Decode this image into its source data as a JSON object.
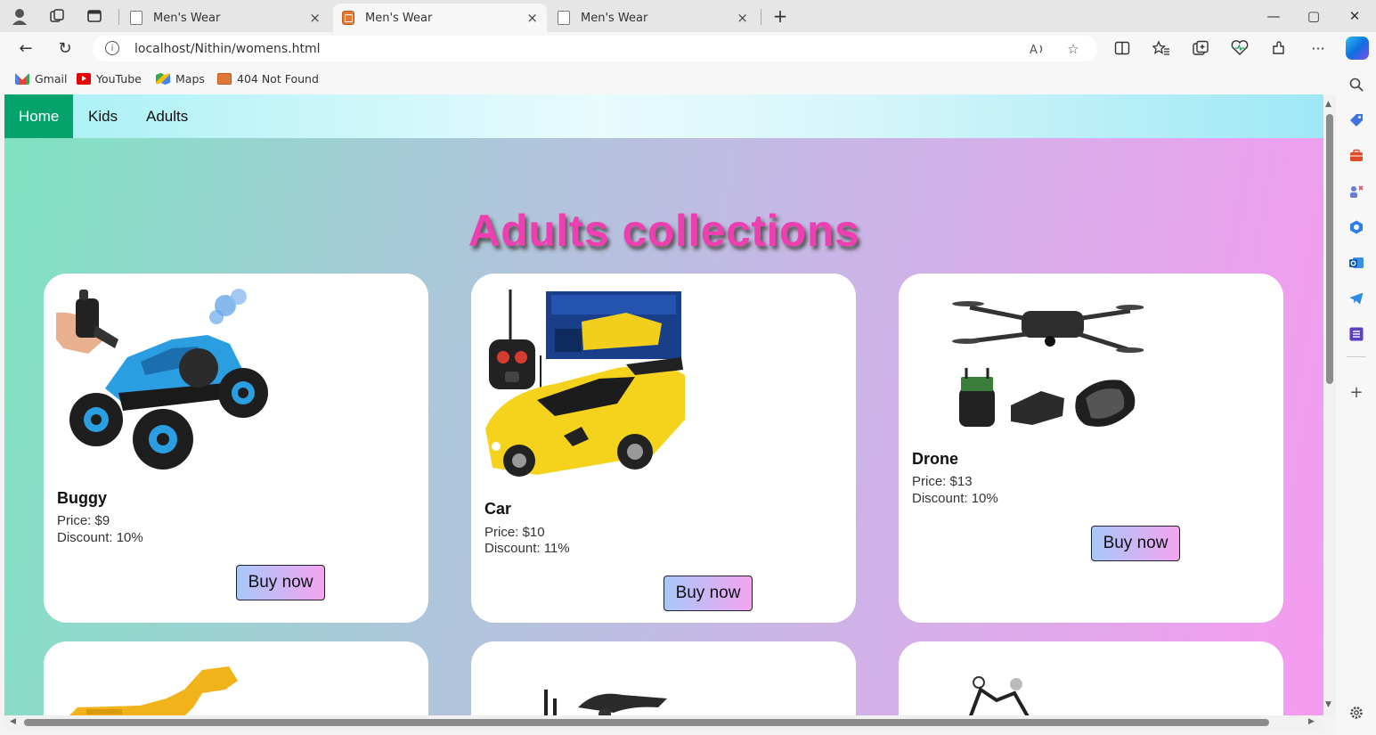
{
  "browser": {
    "tabs": [
      {
        "title": "Men's Wear",
        "close": "×"
      },
      {
        "title": "Men's Wear",
        "close": "×"
      },
      {
        "title": "Men's Wear",
        "close": "×"
      }
    ],
    "new_tab": "+",
    "window_controls": {
      "minimize": "—",
      "restore": "▢",
      "close": "✕"
    },
    "nav": {
      "back": "←",
      "refresh": "↻"
    },
    "address": {
      "url": "localhost/Nithin/womens.html",
      "info": "i"
    },
    "toolbar_icons": [
      "read-aloud-icon",
      "favorite-star-icon",
      "split-screen-icon",
      "favorites-icon",
      "collections-icon",
      "browser-essentials-icon",
      "extensions-icon",
      "more-icon",
      "copilot-icon"
    ],
    "bookmarks": [
      {
        "label": "Gmail",
        "icon": "gmail-icon"
      },
      {
        "label": "YouTube",
        "icon": "youtube-icon"
      },
      {
        "label": "Maps",
        "icon": "maps-icon"
      },
      {
        "label": "404 Not Found",
        "icon": "page-icon"
      }
    ],
    "sidebar_icons": [
      "search-icon",
      "shopping-tag-icon",
      "tools-icon",
      "games-icon",
      "office-icon",
      "outlook-icon",
      "telegram-icon",
      "list-icon",
      "add-icon",
      "settings-icon"
    ]
  },
  "site": {
    "nav": [
      {
        "label": "Home",
        "active": true
      },
      {
        "label": "Kids",
        "active": false
      },
      {
        "label": "Adults",
        "active": false
      }
    ],
    "heading": "Adults collections",
    "colors": {
      "heading": "#ee3fb1",
      "nav_active": "#04a36b"
    },
    "products": [
      {
        "name": "Buggy",
        "price": "Price: $9",
        "discount": "Discount: 10%",
        "button": "Buy now",
        "image": "blue-rc-rock-crawler-image"
      },
      {
        "name": "Car",
        "price": "Price: $10",
        "discount": "Discount: 11%",
        "button": "Buy now",
        "image": "yellow-rc-sports-car-image"
      },
      {
        "name": "Drone",
        "price": "Price: $13",
        "discount": "Discount: 10%",
        "button": "Buy now",
        "image": "black-foldable-drone-image"
      }
    ]
  }
}
